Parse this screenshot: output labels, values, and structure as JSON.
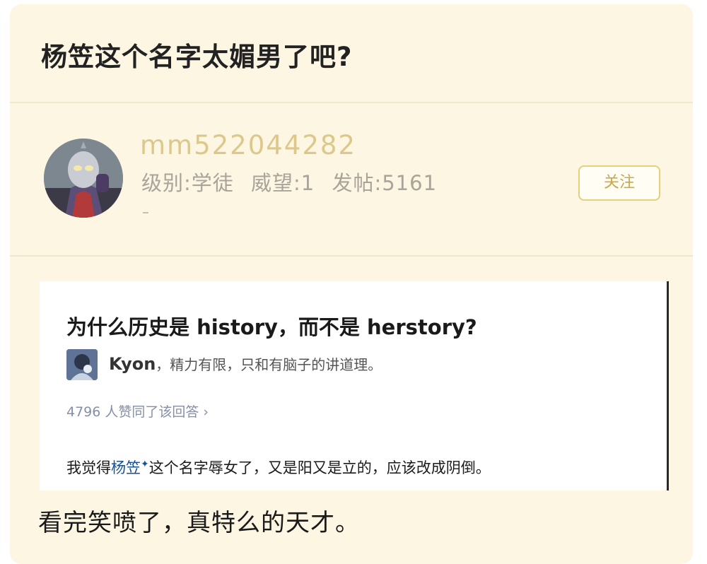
{
  "post": {
    "title": "杨笠这个名字太媚男了吧?"
  },
  "user": {
    "username": "mm522044282",
    "level": "级别:学徒",
    "prestige": "威望:1",
    "posts": "发帖:5161",
    "follow_label": "关注"
  },
  "screenshot": {
    "question": "为什么历史是 history，而不是 herstory?",
    "answerer_name": "Kyon",
    "answerer_bio": "，精力有限，只和有脑子的讲道理。",
    "upvotes": "4796 人赞同了该回答 ›",
    "answer_before": "我觉得",
    "answer_link": "杨笠",
    "answer_mark": "✦",
    "answer_after": "这个名字辱女了，又是阳又是立的，应该改成阴倒。"
  },
  "caption": "看完笑喷了，真特么的天才。",
  "colors": {
    "card_bg": "#fcf6e3",
    "username": "#ddc88b",
    "follow_border": "#e6cf7f",
    "link": "#175199"
  }
}
